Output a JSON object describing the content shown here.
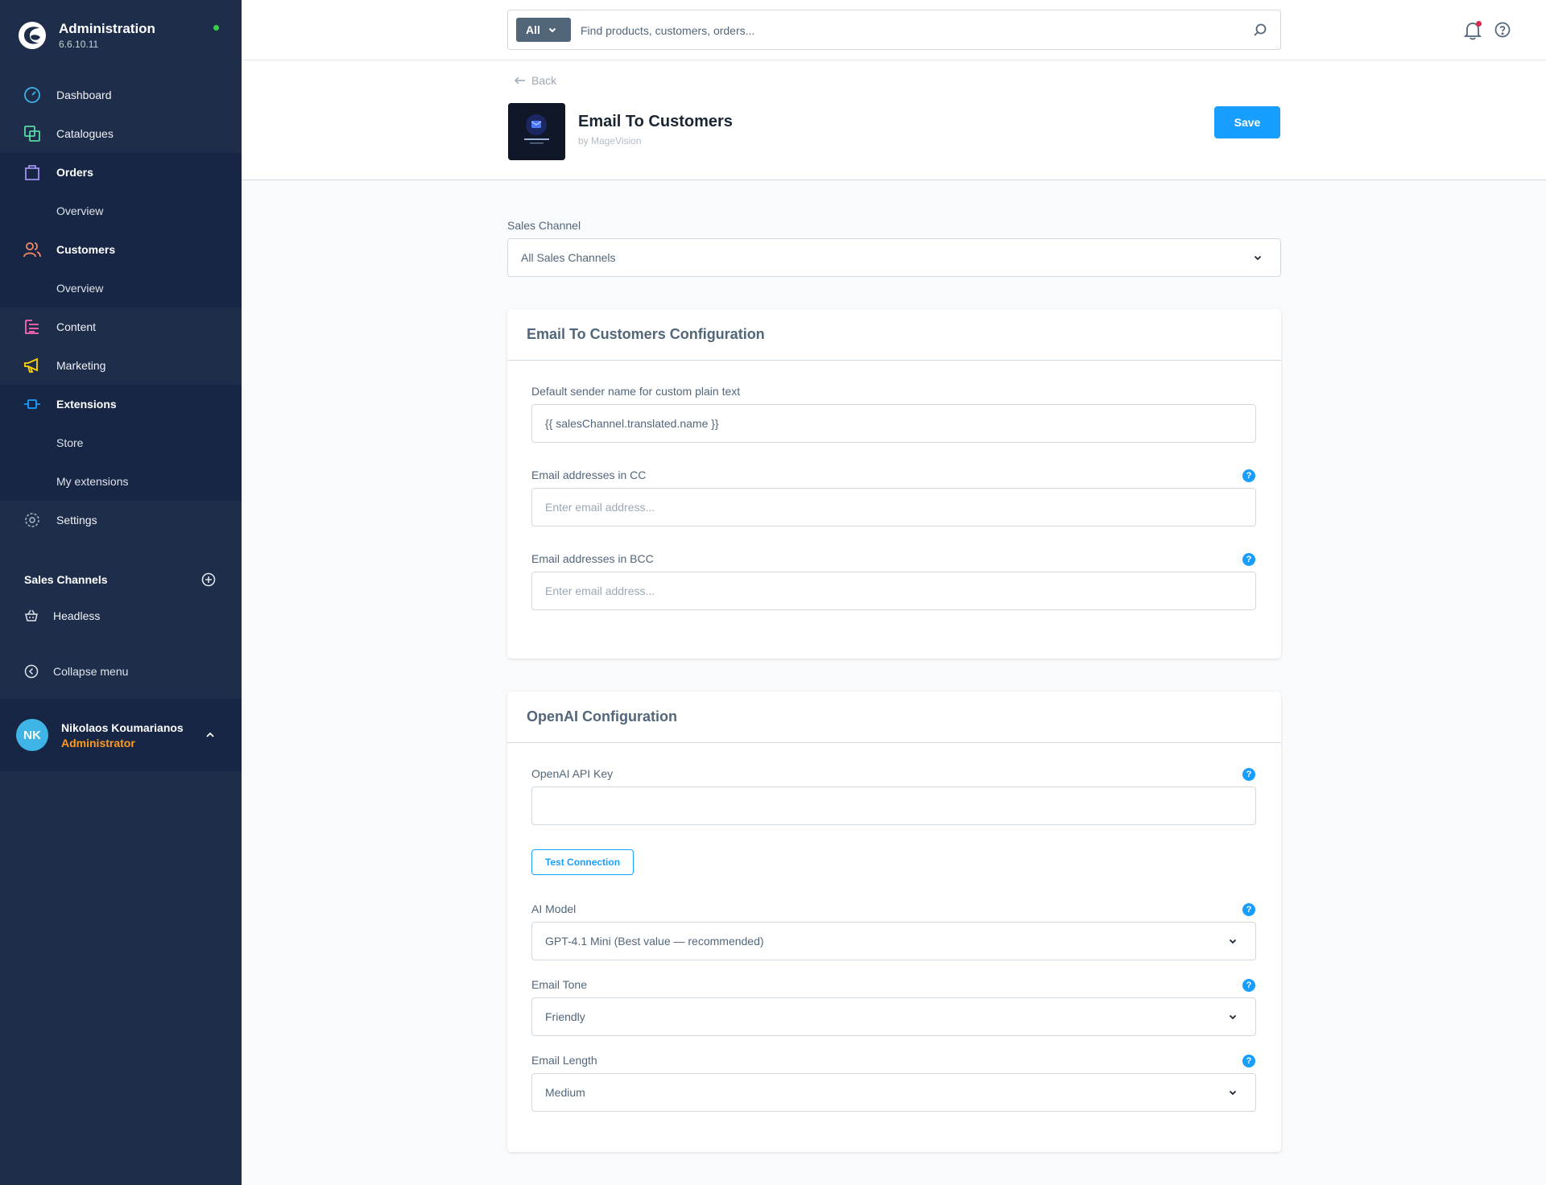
{
  "app": {
    "title": "Administration",
    "version": "6.6.10.11"
  },
  "sidebar": {
    "items": [
      {
        "label": "Dashboard"
      },
      {
        "label": "Catalogues"
      },
      {
        "label": "Orders",
        "sub": [
          "Overview"
        ]
      },
      {
        "label": "Customers",
        "sub": [
          "Overview"
        ]
      },
      {
        "label": "Content"
      },
      {
        "label": "Marketing"
      },
      {
        "label": "Extensions",
        "sub": [
          "Store",
          "My extensions"
        ]
      },
      {
        "label": "Settings"
      }
    ],
    "sales_channels_title": "Sales Channels",
    "sales_channels": [
      "Headless"
    ],
    "collapse_label": "Collapse menu"
  },
  "user": {
    "initials": "NK",
    "name": "Nikolaos Koumarianos",
    "role": "Administrator"
  },
  "search": {
    "type": "All",
    "placeholder": "Find products, customers, orders..."
  },
  "page": {
    "back": "Back",
    "title": "Email To Customers",
    "author": "by MageVision",
    "save": "Save",
    "thumb_text": "EMAIL TO CUSTOMERS"
  },
  "sales_channel": {
    "label": "Sales Channel",
    "value": "All Sales Channels"
  },
  "config": {
    "title": "Email To Customers Configuration",
    "sender_label": "Default sender name for custom plain text",
    "sender_value": "{{ salesChannel.translated.name }}",
    "cc_label": "Email addresses in CC",
    "cc_placeholder": "Enter email address...",
    "bcc_label": "Email addresses in BCC",
    "bcc_placeholder": "Enter email address..."
  },
  "openai": {
    "title": "OpenAI Configuration",
    "api_key_label": "OpenAI API Key",
    "api_key_value": "",
    "test_button": "Test Connection",
    "model_label": "AI Model",
    "model_value": "GPT-4.1 Mini (Best value — recommended)",
    "tone_label": "Email Tone",
    "tone_value": "Friendly",
    "length_label": "Email Length",
    "length_value": "Medium"
  },
  "colors": {
    "sidebar": "#1e2d4a",
    "accent": "#189eff",
    "role": "#ff9a1f"
  }
}
